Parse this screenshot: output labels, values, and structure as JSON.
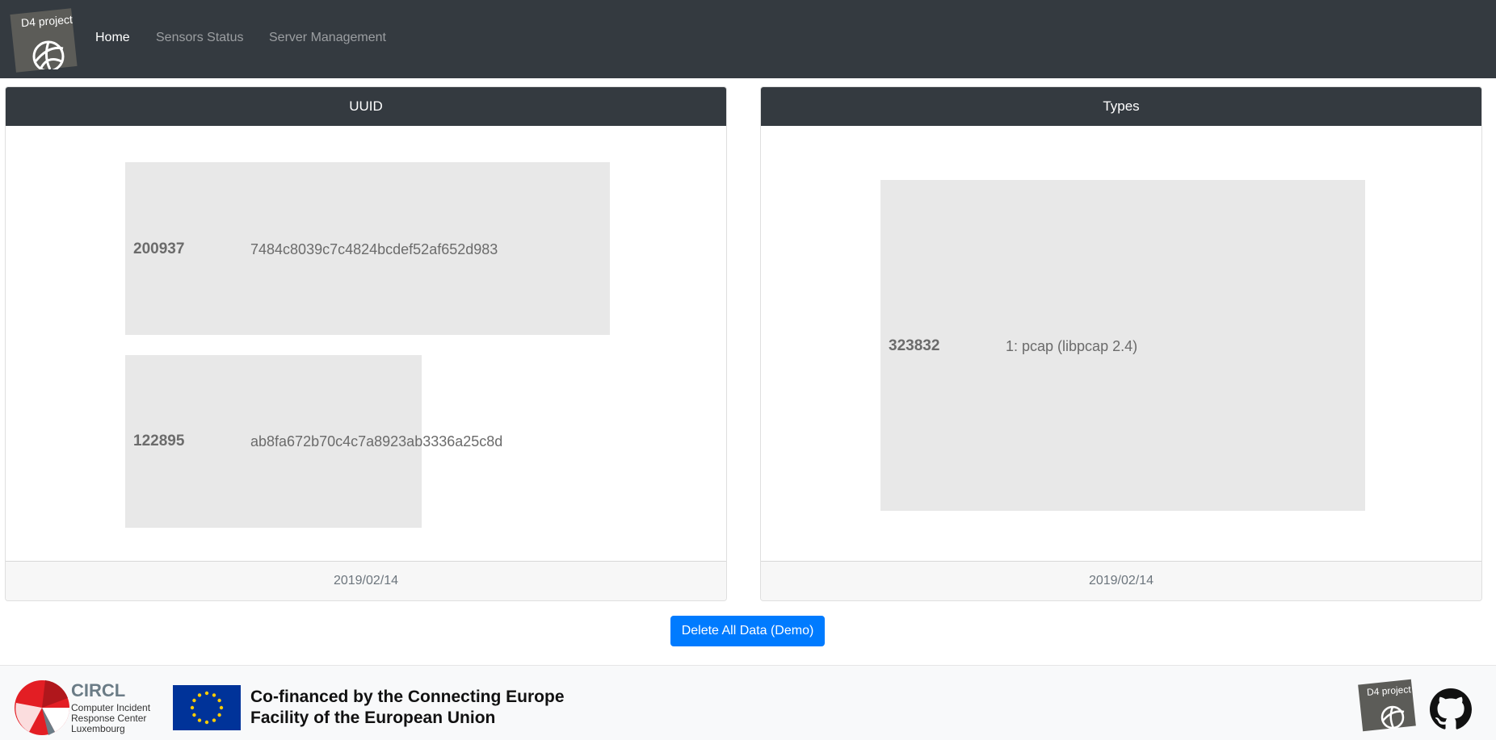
{
  "navbar": {
    "brand_text": "D4 project",
    "links": [
      {
        "label": "Home",
        "active": true
      },
      {
        "label": "Sensors Status",
        "active": false
      },
      {
        "label": "Server Management",
        "active": false
      }
    ]
  },
  "uuid_card": {
    "header": "UUID",
    "footer": "2019/02/14",
    "items": [
      {
        "count": "200937",
        "label": "7484c8039c7c4824bcdef52af652d983"
      },
      {
        "count": "122895",
        "label": "ab8fa672b70c4c7a8923ab3336a25c8d"
      }
    ]
  },
  "types_card": {
    "header": "Types",
    "footer": "2019/02/14",
    "items": [
      {
        "count": "323832",
        "label": "1: pcap (libpcap 2.4)"
      }
    ]
  },
  "actions": {
    "delete_label": "Delete All Data (Demo)",
    "button_color": "#007bff"
  },
  "footer": {
    "circl_name": "CIRCL",
    "circl_lines": [
      "Computer Incident",
      "Response Center",
      "Luxembourg"
    ],
    "cofinanced_line1": "Co-financed by the Connecting Europe",
    "cofinanced_line2": "Facility of the European Union",
    "d4_text": "D4 project"
  },
  "colors": {
    "navbar_bg": "#343a40",
    "cell_bg": "#e8e8e8",
    "accent": "#007bff",
    "circl_red": "#e31e24"
  }
}
